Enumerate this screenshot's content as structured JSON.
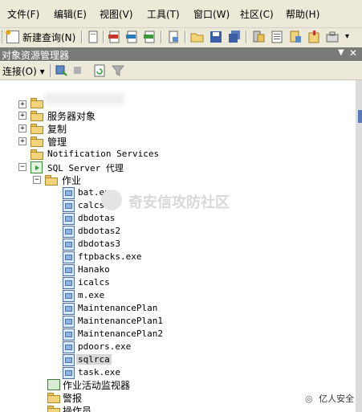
{
  "menu": {
    "items": [
      "文件(F)",
      "编辑(E)",
      "视图(V)",
      "工具(T)",
      "窗口(W)",
      "社区(C)",
      "帮助(H)"
    ]
  },
  "toolbar": {
    "new_query_label": "新建查询(N)",
    "icons": [
      "new-query-icon",
      "new-file-icon",
      "mdx-query-icon",
      "dmx-query-icon",
      "xmla-query-icon",
      "sql-ce-query-icon",
      "open-file-icon",
      "save-icon",
      "save-all-icon",
      "registered-servers-icon",
      "object-explorer-icon",
      "template-explorer-icon",
      "properties-icon",
      "toolbox-icon"
    ]
  },
  "panel": {
    "title": "对象资源管理器",
    "pin": "▼",
    "close": "✕",
    "connect_label": "连接(O) ▾"
  },
  "tree": {
    "server_objects": "服务器对象",
    "replication": "复制",
    "management": "管理",
    "notification_services": "Notification Services",
    "sql_agent": "SQL Server 代理",
    "jobs_folder": "作业",
    "jobs": [
      "bat.exe",
      "calcs",
      "dbdotas",
      "dbdotas2",
      "dbdotas3",
      "ftpbacks.exe",
      "Hanako",
      "icalcs",
      "m.exe",
      "MaintenancePlan",
      "MaintenancePlan1",
      "MaintenancePlan2",
      "pdoors.exe",
      "sqlrca",
      "task.exe"
    ],
    "job_activity_monitor": "作业活动监视器",
    "alerts": "警报",
    "operators": "操作员"
  },
  "watermark": "奇安信攻防社区",
  "corner_badge": "亿人安全"
}
